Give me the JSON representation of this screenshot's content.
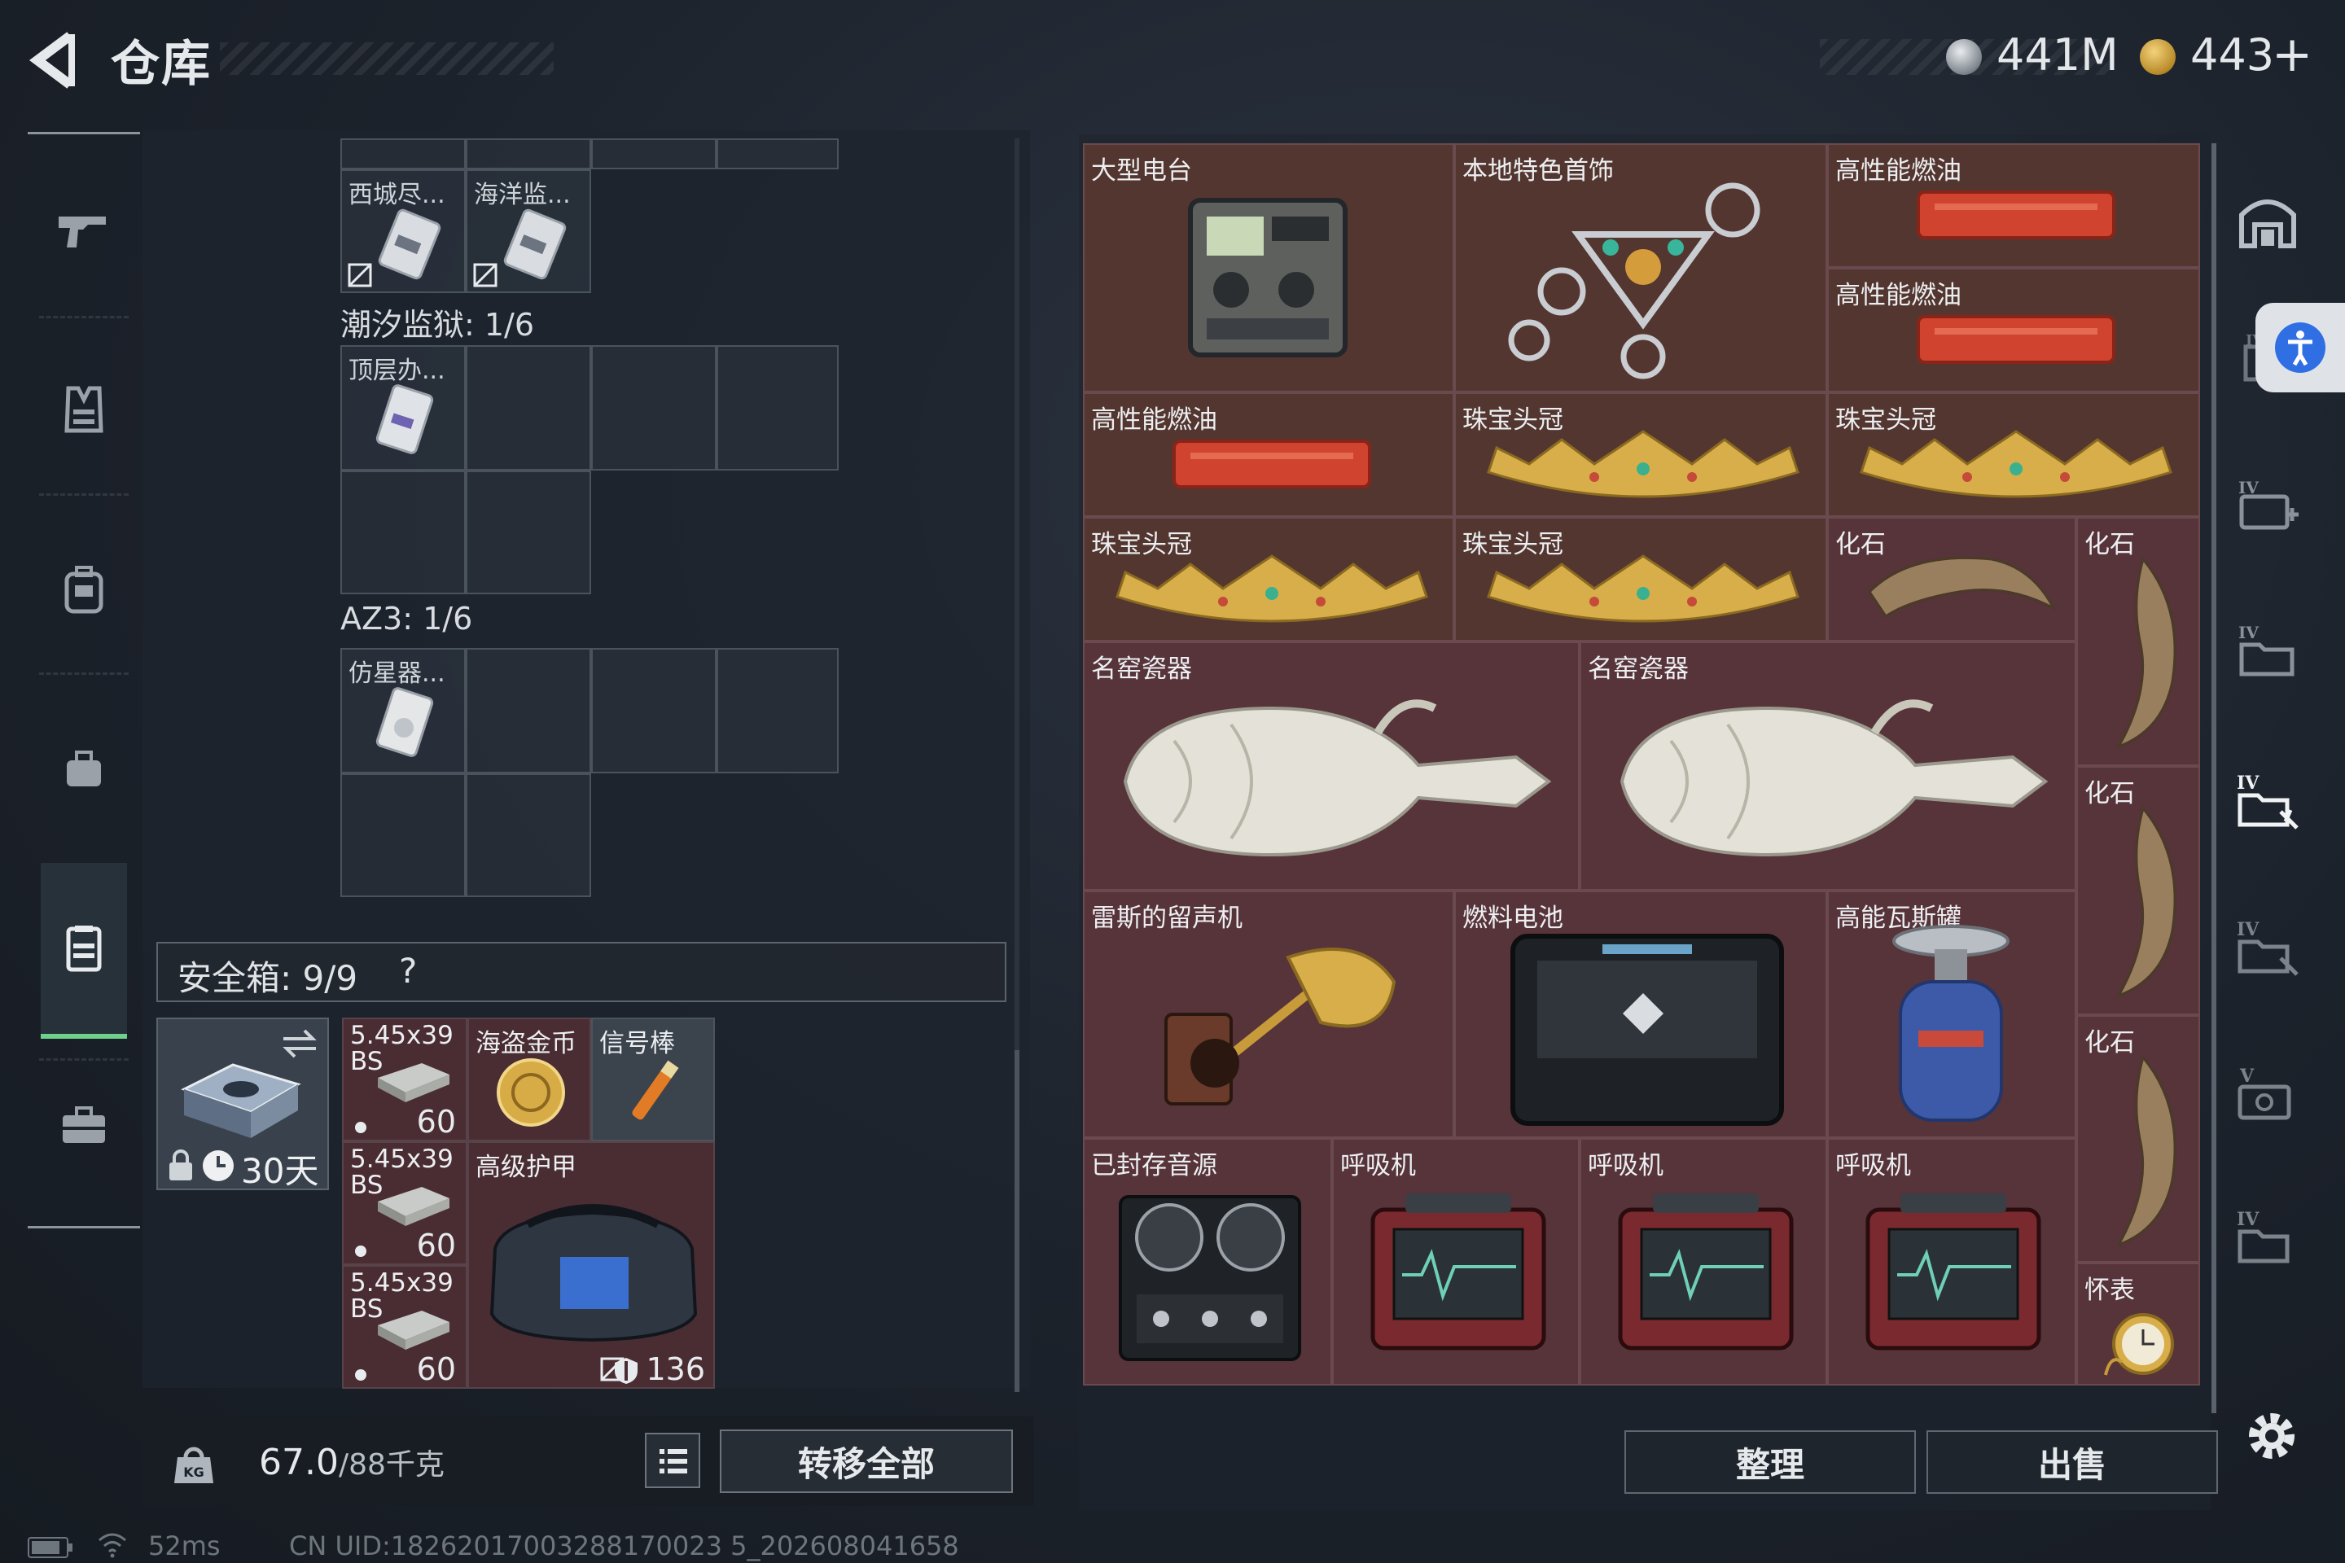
{
  "header": {
    "title": "仓库",
    "currency1": "441M",
    "currency2": "443",
    "plus": "+"
  },
  "left_nav": {
    "items": [
      "gun-icon",
      "vest-icon",
      "backpack-icon",
      "pouch-icon",
      "safebox-icon",
      "briefcase-icon"
    ]
  },
  "storage": {
    "group1": {
      "items": [
        {
          "label": "西城尽..."
        },
        {
          "label": "海洋监..."
        }
      ]
    },
    "group2": {
      "title": "潮汐监狱: 1/6",
      "items": [
        {
          "label": "顶层办..."
        }
      ]
    },
    "group3": {
      "title": "AZ3: 1/6",
      "items": [
        {
          "label": "仿星器..."
        }
      ]
    }
  },
  "safe": {
    "label": "安全箱: 9/9",
    "help": "?",
    "timer": "30天",
    "items": [
      {
        "label": "5.45x39 BS",
        "count": "60"
      },
      {
        "label": "海盗金币"
      },
      {
        "label": "信号棒"
      },
      {
        "label": "5.45x39 BS",
        "count": "60"
      },
      {
        "label": "高级护甲",
        "durability": "136"
      },
      {
        "label": "5.45x39 BS",
        "count": "60"
      }
    ]
  },
  "bottom_left": {
    "weight": "67.0",
    "weight_max": "/88千克",
    "transfer_label": "转移全部"
  },
  "container": {
    "items": [
      {
        "label": "大型电台"
      },
      {
        "label": "本地特色首饰"
      },
      {
        "label": "高性能燃油"
      },
      {
        "label": "高性能燃油"
      },
      {
        "label": "高性能燃油"
      },
      {
        "label": "珠宝头冠"
      },
      {
        "label": "珠宝头冠"
      },
      {
        "label": "珠宝头冠"
      },
      {
        "label": "珠宝头冠"
      },
      {
        "label": "化石"
      },
      {
        "label": "化石"
      },
      {
        "label": "名窑瓷器"
      },
      {
        "label": "名窑瓷器"
      },
      {
        "label": "化石"
      },
      {
        "label": "雷斯的留声机"
      },
      {
        "label": "燃料电池"
      },
      {
        "label": "高能瓦斯罐"
      },
      {
        "label": "化石"
      },
      {
        "label": "已封存音源"
      },
      {
        "label": "呼吸机"
      },
      {
        "label": "呼吸机"
      },
      {
        "label": "呼吸机"
      },
      {
        "label": "怀表"
      }
    ]
  },
  "actions": {
    "sort_label": "整理",
    "sell_label": "出售"
  },
  "status": {
    "ping": "52ms",
    "uid": "CN UID:18262017003288170023 5_202608041658"
  },
  "colors": {
    "accent_green": "#6fcf8d",
    "item_red": "#57333a",
    "item_brown": "#543630",
    "accessibility_blue": "#2f6fe3"
  }
}
